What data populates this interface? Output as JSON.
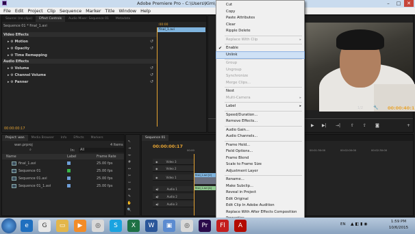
{
  "window": {
    "title": "Adobe Premiere Pro - C:\\Users\\Kim\\"
  },
  "menubar": [
    "File",
    "Edit",
    "Project",
    "Clip",
    "Sequence",
    "Marker",
    "Title",
    "Window",
    "Help"
  ],
  "effect_controls": {
    "tabs": [
      "Source: (no clips)",
      "Effect Controls",
      "Audio Mixer: Sequence 01",
      "Metadata"
    ],
    "clip_label": "Sequence 01 * final_1.avi",
    "clip_name_on_timeline": "final_1.avi",
    "time_marker": ":00:00",
    "video_effects_header": "Video Effects",
    "video_effects": [
      "Motion",
      "Opacity",
      "Time Remapping"
    ],
    "audio_effects_header": "Audio Effects",
    "audio_effects": [
      "Volume",
      "Channel Volume",
      "Panner"
    ],
    "timecode": "00:00:00:17"
  },
  "program_monitor": {
    "fraction": "1/2",
    "timecode": "00:00:40:17"
  },
  "project_panel": {
    "tabs": [
      "Project: wan",
      "Media Browser",
      "Info",
      "Effects",
      "Markers"
    ],
    "file_name": "wan.prproj",
    "item_count": "4 Items",
    "in_label": "In:",
    "in_value": "All",
    "columns": [
      "Name",
      "Label",
      "Frame Rate"
    ],
    "items": [
      {
        "name": "final_1.avi",
        "frame_rate": "25.00 fps",
        "label_color": "#6f9fd8"
      },
      {
        "name": "Sequence 01",
        "frame_rate": "25.00 fps",
        "label_color": "#39b54a"
      },
      {
        "name": "Sequence 01.avi",
        "frame_rate": "25.00 fps",
        "label_color": "#6f9fd8"
      },
      {
        "name": "Sequence 01_1.avi",
        "frame_rate": "25.00 fps",
        "label_color": "#6f9fd8"
      }
    ]
  },
  "timeline": {
    "tab": "Sequence 01",
    "timecode": "00:00:00:17",
    "ruler": [
      "00:00",
      "00:00:30:00",
      "00:01:00:00",
      "00:01:30:00",
      "00:02:00:00",
      "00:02:30:00"
    ],
    "tracks": [
      "Video 3",
      "Video 2",
      "Video 1",
      "Audio 1",
      "Audio 2",
      "Audio 3"
    ],
    "video_clip": "final_1.avi [V]",
    "audio_clip": "final_1.avi [A]"
  },
  "context_menu": {
    "items": [
      {
        "label": "Cut",
        "state": "normal"
      },
      {
        "label": "Copy",
        "state": "normal"
      },
      {
        "label": "Paste Attributes",
        "state": "normal"
      },
      {
        "label": "Clear",
        "state": "normal"
      },
      {
        "label": "Ripple Delete",
        "state": "normal"
      },
      {
        "label": "Replace With Clip",
        "state": "disabled",
        "submenu": true
      },
      {
        "label": "Enable",
        "state": "checked"
      },
      {
        "label": "Unlink",
        "state": "highlighted"
      },
      {
        "label": "Group",
        "state": "disabled"
      },
      {
        "label": "Ungroup",
        "state": "disabled"
      },
      {
        "label": "Synchronize",
        "state": "disabled"
      },
      {
        "label": "Merge Clips...",
        "state": "disabled"
      },
      {
        "label": "Nest",
        "state": "normal"
      },
      {
        "label": "Multi-Camera",
        "state": "disabled",
        "submenu": true
      },
      {
        "label": "Label",
        "state": "normal",
        "submenu": true
      },
      {
        "label": "Speed/Duration...",
        "state": "normal"
      },
      {
        "label": "Remove Effects...",
        "state": "normal"
      },
      {
        "label": "Audio Gain...",
        "state": "normal"
      },
      {
        "label": "Audio Channels...",
        "state": "normal"
      },
      {
        "label": "Frame Hold...",
        "state": "normal"
      },
      {
        "label": "Field Options...",
        "state": "normal"
      },
      {
        "label": "Frame Blend",
        "state": "normal"
      },
      {
        "label": "Scale to Frame Size",
        "state": "normal"
      },
      {
        "label": "Adjustment Layer",
        "state": "normal"
      },
      {
        "label": "Rename...",
        "state": "normal"
      },
      {
        "label": "Make Subclip...",
        "state": "normal"
      },
      {
        "label": "Reveal in Project",
        "state": "normal"
      },
      {
        "label": "Edit Original",
        "state": "normal"
      },
      {
        "label": "Edit Clip In Adobe Audition",
        "state": "normal"
      },
      {
        "label": "Replace With After Effects Composition",
        "state": "normal"
      },
      {
        "label": "Properties",
        "state": "normal"
      },
      {
        "label": "Show Clip Keyframes",
        "state": "normal",
        "submenu": true
      }
    ]
  },
  "taskbar": {
    "icons": [
      "ie-icon",
      "google-icon",
      "folder-icon",
      "media-icon",
      "chrome-icon",
      "skype-icon",
      "excel-icon",
      "word-icon",
      "photos-icon",
      "chrome-icon",
      "premiere-icon",
      "flash-icon",
      "adobe-icon"
    ],
    "language": "EN",
    "time": "1:59 PM",
    "date": "10/6/2015"
  }
}
